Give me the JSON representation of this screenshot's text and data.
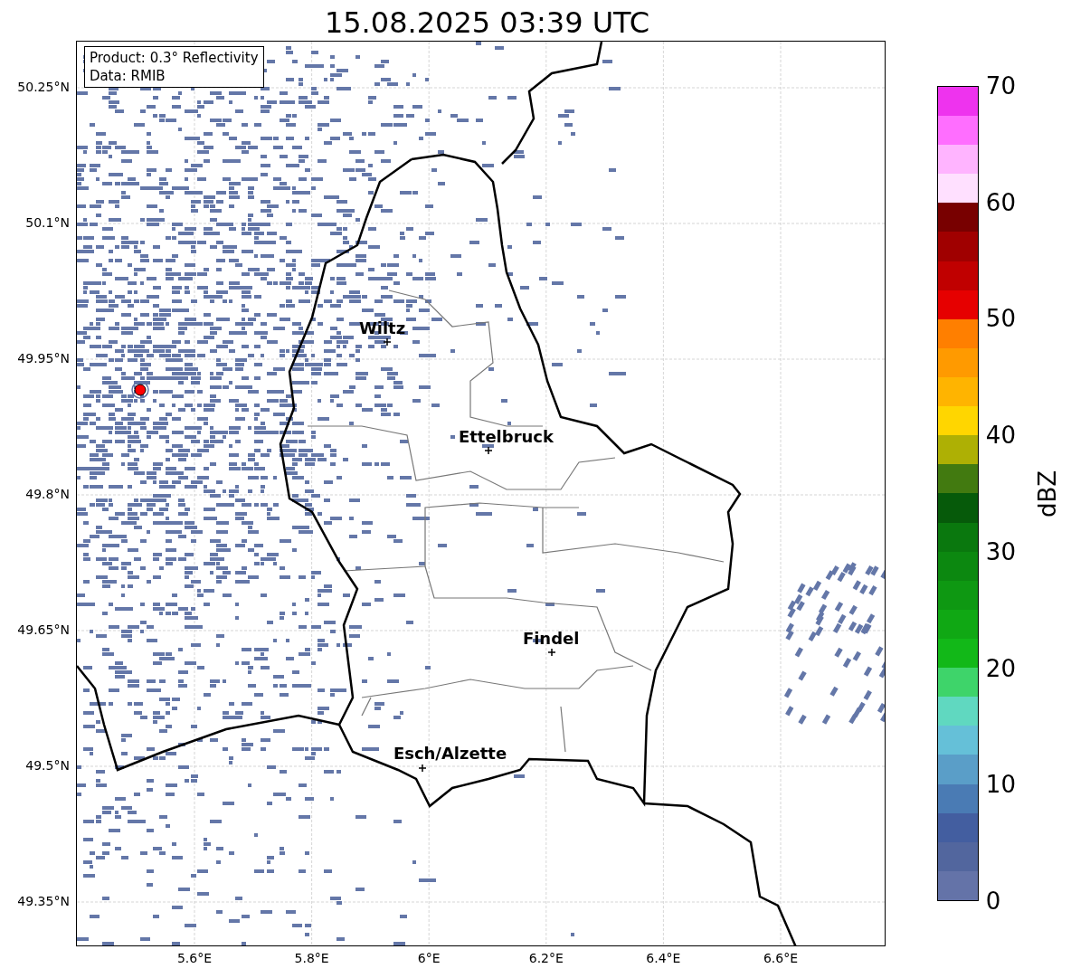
{
  "title": "15.08.2025 03:39 UTC",
  "legend": {
    "lines": [
      "Product: 0.3° Reflectivity",
      "Data: RMIB"
    ]
  },
  "map": {
    "y_ticks": [
      "50.25°N",
      "50.1°N",
      "49.95°N",
      "49.8°N",
      "49.65°N",
      "49.5°N",
      "49.35°N"
    ],
    "x_ticks": [
      "5.6°E",
      "5.8°E",
      "6°E",
      "6.2°E",
      "6.4°E",
      "6.6°E"
    ],
    "cities": [
      {
        "name": "Wiltz"
      },
      {
        "name": "Ettelbruck"
      },
      {
        "name": "Findel"
      },
      {
        "name": "Esch/Alzette"
      }
    ]
  },
  "colorbar": {
    "label": "dBZ",
    "ticks": [
      "70",
      "60",
      "50",
      "40",
      "30",
      "20",
      "10",
      "0"
    ],
    "bands": [
      {
        "color": "#6473a8"
      },
      {
        "color": "#52669e"
      },
      {
        "color": "#435ea0"
      },
      {
        "color": "#4a7bb4"
      },
      {
        "color": "#5a9ec8"
      },
      {
        "color": "#65c0d8"
      },
      {
        "color": "#60d8c0"
      },
      {
        "color": "#3ed46a"
      },
      {
        "color": "#12b818"
      },
      {
        "color": "#10a814"
      },
      {
        "color": "#0e9812"
      },
      {
        "color": "#0c8810"
      },
      {
        "color": "#0a780e"
      },
      {
        "color": "#065a0a"
      },
      {
        "color": "#427a10"
      },
      {
        "color": "#aeb004"
      },
      {
        "color": "#ffd600"
      },
      {
        "color": "#ffb400"
      },
      {
        "color": "#ff9a00"
      },
      {
        "color": "#ff7f00"
      },
      {
        "color": "#e60000"
      },
      {
        "color": "#c00000"
      },
      {
        "color": "#a00000"
      },
      {
        "color": "#780000"
      },
      {
        "color": "#ffe0ff"
      },
      {
        "color": "#ffb4ff"
      },
      {
        "color": "#ff6eff"
      },
      {
        "color": "#ee33ee"
      }
    ]
  }
}
